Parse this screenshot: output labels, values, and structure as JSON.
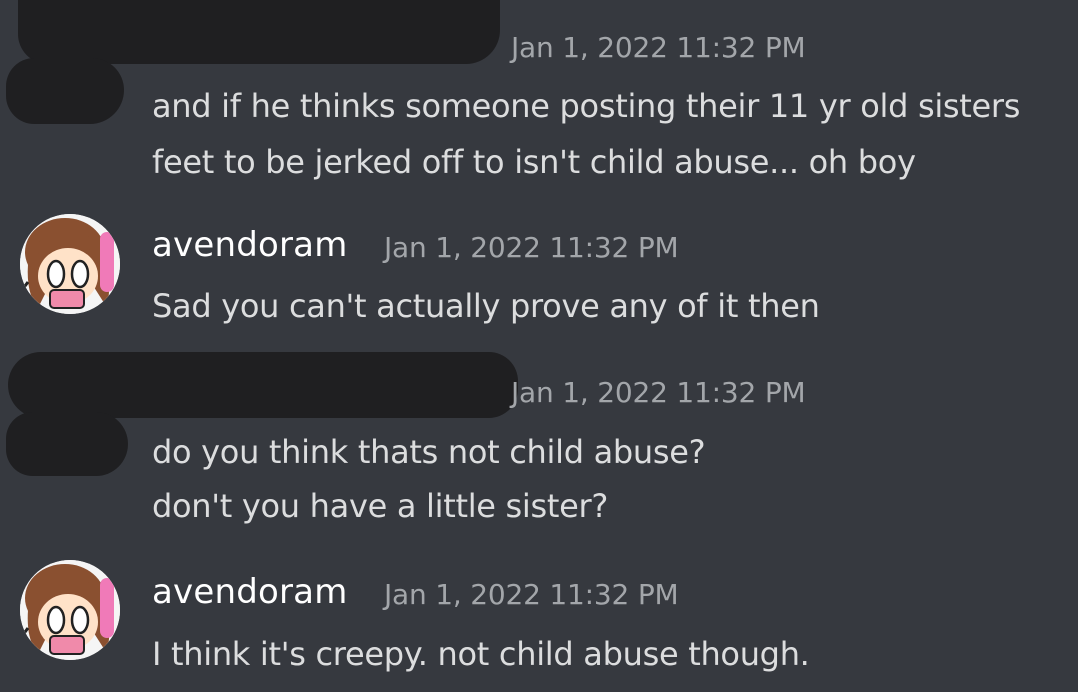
{
  "colors": {
    "background": "#36393f",
    "message_text": "#dcddde",
    "username": "#ffffff",
    "timestamp": "#a3a6aa",
    "redaction": "#1f1f21"
  },
  "messages": [
    {
      "author_redacted": true,
      "timestamp": "Jan 1, 2022 11:32 PM",
      "lines": [
        "and if he thinks someone posting their 11 yr old sisters",
        "feet to be jerked off to isn't child abuse... oh boy"
      ]
    },
    {
      "author": "avendoram",
      "avatar_icon": "anime-girl-avatar-icon",
      "timestamp": "Jan 1, 2022 11:32 PM",
      "lines": [
        "Sad you can't actually prove any of it then"
      ]
    },
    {
      "author_redacted": true,
      "timestamp": "Jan 1, 2022 11:32 PM",
      "lines": [
        "do you think thats not child abuse?",
        "don't you have a little sister?"
      ]
    },
    {
      "author": "avendoram",
      "avatar_icon": "anime-girl-avatar-icon",
      "timestamp": "Jan 1, 2022 11:32 PM",
      "lines": [
        "I think it's creepy. not child abuse though."
      ]
    }
  ]
}
